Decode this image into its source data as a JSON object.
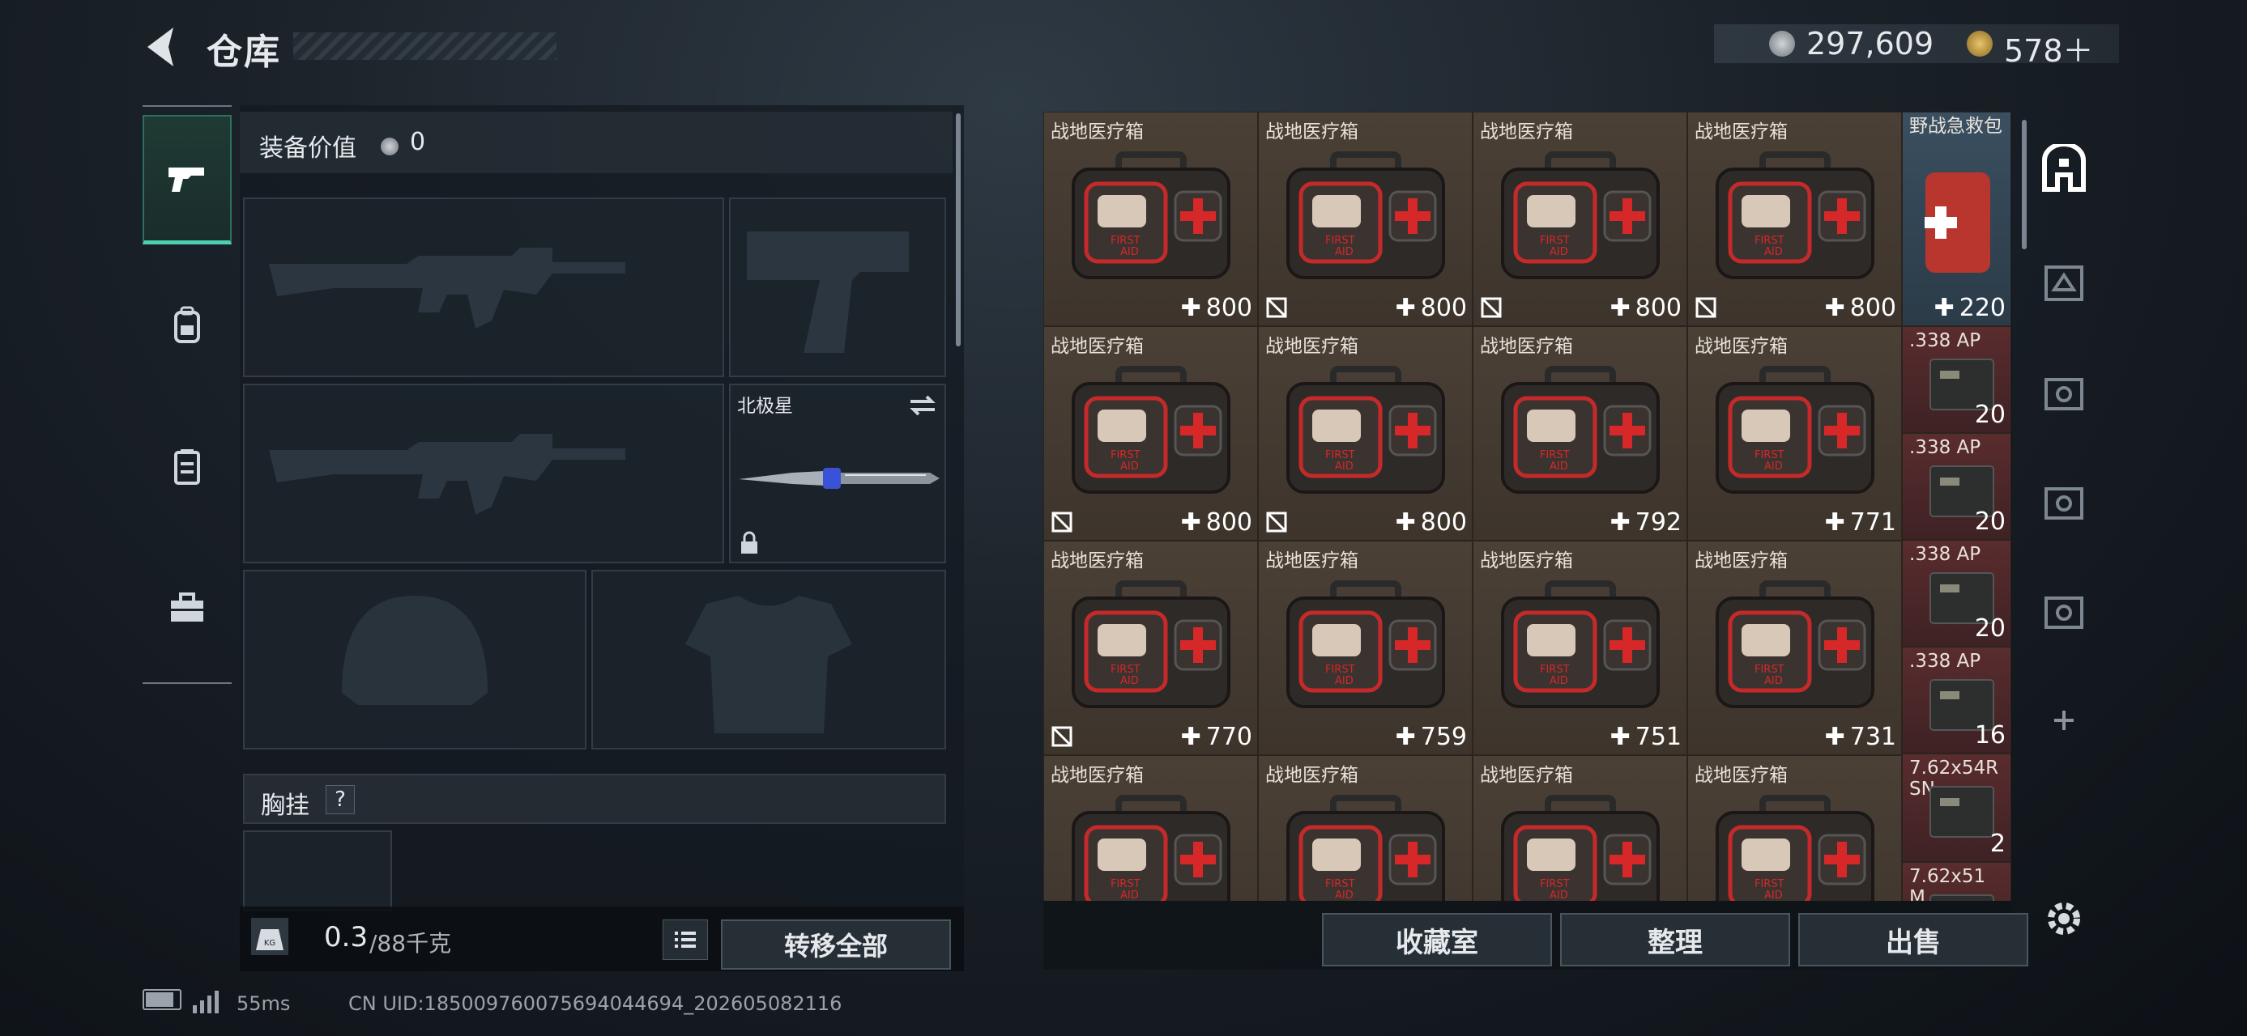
{
  "header": {
    "title": "仓库",
    "currency1": "297,609",
    "currency2": "578＋"
  },
  "equipment": {
    "value_label": "装备价值",
    "value": "0",
    "melee_name": "北极星",
    "chest_label": "胸挂",
    "chest_help": "?",
    "weight": "0.3",
    "weight_max": "/88千克",
    "transfer_all": "转移全部"
  },
  "inventory": {
    "items": [
      {
        "name": "战地医疗箱",
        "count": "800",
        "kind": "med",
        "no_sell": false
      },
      {
        "name": "战地医疗箱",
        "count": "800",
        "kind": "med",
        "no_sell": true
      },
      {
        "name": "战地医疗箱",
        "count": "800",
        "kind": "med",
        "no_sell": true
      },
      {
        "name": "战地医疗箱",
        "count": "800",
        "kind": "med",
        "no_sell": true
      },
      {
        "name": "战地医疗箱",
        "count": "800",
        "kind": "med",
        "no_sell": true
      },
      {
        "name": "战地医疗箱",
        "count": "800",
        "kind": "med",
        "no_sell": true
      },
      {
        "name": "战地医疗箱",
        "count": "792",
        "kind": "med",
        "no_sell": false
      },
      {
        "name": "战地医疗箱",
        "count": "771",
        "kind": "med",
        "no_sell": false
      },
      {
        "name": "战地医疗箱",
        "count": "770",
        "kind": "med",
        "no_sell": true
      },
      {
        "name": "战地医疗箱",
        "count": "759",
        "kind": "med",
        "no_sell": false
      },
      {
        "name": "战地医疗箱",
        "count": "751",
        "kind": "med",
        "no_sell": false
      },
      {
        "name": "战地医疗箱",
        "count": "731",
        "kind": "med",
        "no_sell": false
      },
      {
        "name": "战地医疗箱",
        "count": "",
        "kind": "med",
        "no_sell": false
      },
      {
        "name": "战地医疗箱",
        "count": "",
        "kind": "med",
        "no_sell": false
      },
      {
        "name": "战地医疗箱",
        "count": "",
        "kind": "med",
        "no_sell": false
      },
      {
        "name": "战地医疗箱",
        "count": "",
        "kind": "med",
        "no_sell": false
      }
    ],
    "side_items": [
      {
        "name": "野战急救包",
        "count": "220",
        "kind": "blue"
      },
      {
        "name": ".338 AP",
        "count": "20",
        "kind": "red"
      },
      {
        "name": ".338 AP",
        "count": "20",
        "kind": "red"
      },
      {
        "name": ".338 AP",
        "count": "20",
        "kind": "red"
      },
      {
        "name": ".338 AP",
        "count": "16",
        "kind": "red"
      },
      {
        "name": "7.62x54R SN",
        "count": "2",
        "kind": "red"
      },
      {
        "name": "7.62x51 M",
        "count": "",
        "kind": "red"
      }
    ],
    "buttons": {
      "collection": "收藏室",
      "sort": "整理",
      "sell": "出售"
    }
  },
  "status": {
    "ping": "55ms",
    "uid": "CN UID:185009760075694044694_202605082116"
  },
  "colors": {
    "accent": "#4dd0b0",
    "medbg": "#3d342c",
    "ammo": "#5a2c2e"
  }
}
